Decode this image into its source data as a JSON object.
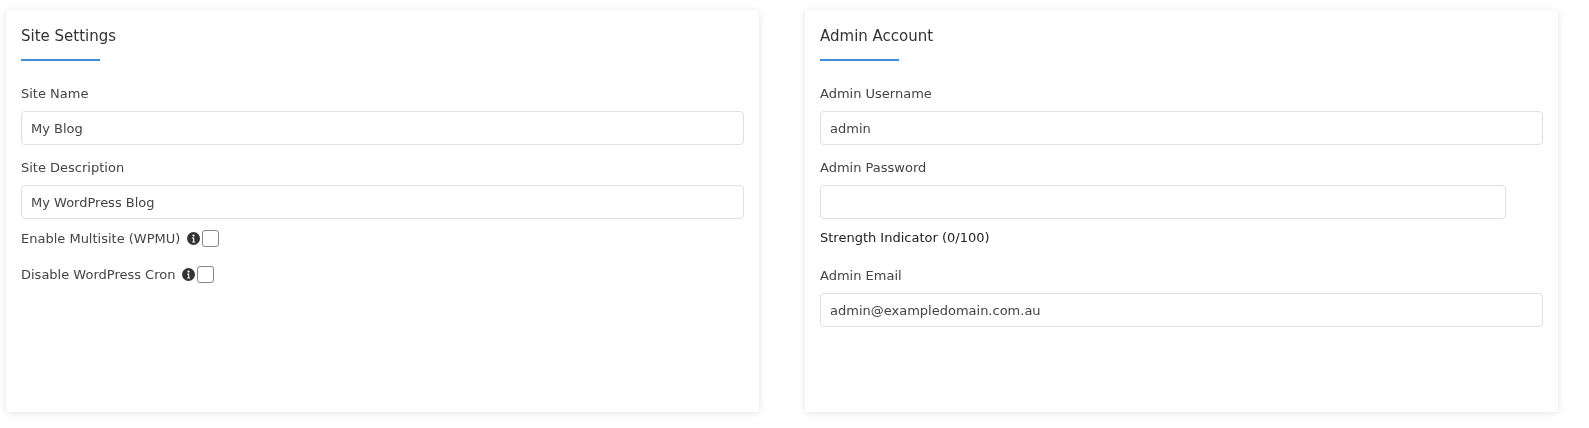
{
  "cards": [
    {
      "title": "Site Settings",
      "items": [
        {
          "kind": "text",
          "label": "Site Name",
          "value": "My Blog"
        },
        {
          "kind": "text",
          "label": "Site Description",
          "value": "My WordPress Blog"
        },
        {
          "kind": "checkbox",
          "label": "Enable Multisite (WPMU)",
          "checked": false
        },
        {
          "kind": "checkbox",
          "label": "Disable WordPress Cron",
          "checked": false
        }
      ]
    },
    {
      "title": "Admin Account",
      "items": [
        {
          "kind": "text",
          "label": "Admin Username",
          "value": "admin"
        },
        {
          "kind": "password",
          "label": "Admin Password",
          "value": ""
        },
        {
          "kind": "note",
          "label": "Strength Indicator (0/100)"
        },
        {
          "kind": "text",
          "label": "Admin Email",
          "value": "admin@exampledomain.com.au"
        }
      ]
    }
  ]
}
